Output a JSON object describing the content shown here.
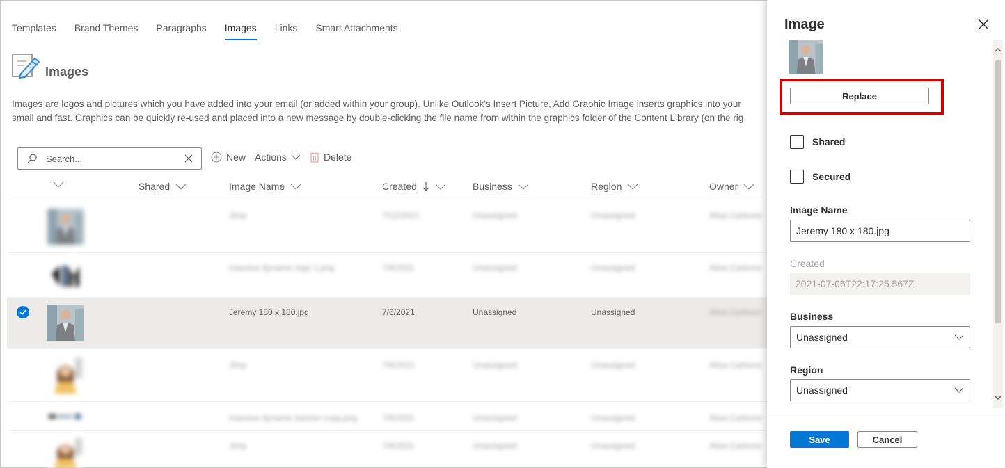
{
  "nav": {
    "tabs": [
      {
        "label": "Templates"
      },
      {
        "label": "Brand Themes"
      },
      {
        "label": "Paragraphs"
      },
      {
        "label": "Images",
        "active": true
      },
      {
        "label": "Links"
      },
      {
        "label": "Smart Attachments"
      }
    ]
  },
  "page": {
    "title": "Images",
    "icon": "image-edit-icon",
    "description_line1": "Images are logos and pictures which you have added into your email (or added within your group). Unlike Outlook's Insert Picture, Add Graphic Image inserts graphics into your",
    "description_line2": "small and fast. Graphics can be quickly re-used and placed into a new message by double-clicking the file name from within the graphics folder of the Content Library (on the rig"
  },
  "toolbar": {
    "search_placeholder": "Search...",
    "new_label": "New",
    "actions_label": "Actions",
    "delete_label": "Delete"
  },
  "table": {
    "columns": {
      "shared": "Shared",
      "image_name": "Image Name",
      "created": "Created",
      "business": "Business",
      "region": "Region",
      "owner": "Owner"
    },
    "rows": [
      {
        "name": "Jimp",
        "created": "7/12/2021",
        "business": "Unassigned",
        "region": "Unassigned",
        "owner": "Alisa Carbone",
        "thumb": "man",
        "selected": false
      },
      {
        "name": "massive dynamic logo 1.png",
        "created": "7/6/2021",
        "business": "Unassigned",
        "region": "Unassigned",
        "owner": "Alisa Carbone",
        "thumb": "logo",
        "selected": false
      },
      {
        "name": "Jeremy 180 x 180.jpg",
        "created": "7/6/2021",
        "business": "Unassigned",
        "region": "Unassigned",
        "owner": "Alisa Carbone",
        "thumb": "man",
        "selected": true
      },
      {
        "name": "Jimp",
        "created": "7/6/2021",
        "business": "Unassigned",
        "region": "Unassigned",
        "owner": "Alisa Carbone",
        "thumb": "woman",
        "selected": false
      },
      {
        "name": "massive dynamic banner copy.png",
        "created": "7/6/2021",
        "business": "Unassigned",
        "region": "Unassigned",
        "owner": "Alisa Carbone",
        "thumb": "banner",
        "selected": false
      },
      {
        "name": "Jimp",
        "created": "7/6/2021",
        "business": "Unassigned",
        "region": "Unassigned",
        "owner": "Alisa Carbone",
        "thumb": "woman",
        "selected": false
      }
    ]
  },
  "panel": {
    "title": "Image",
    "replace_label": "Replace",
    "shared_label": "Shared",
    "secured_label": "Secured",
    "image_name_label": "Image Name",
    "image_name_value": "Jeremy 180 x 180.jpg",
    "created_label": "Created",
    "created_value": "2021-07-06T22:17:25.567Z",
    "business_label": "Business",
    "business_value": "Unassigned",
    "region_label": "Region",
    "region_value": "Unassigned",
    "save_label": "Save",
    "cancel_label": "Cancel"
  },
  "colors": {
    "accent": "#0078d4",
    "highlight": "#d40000"
  }
}
